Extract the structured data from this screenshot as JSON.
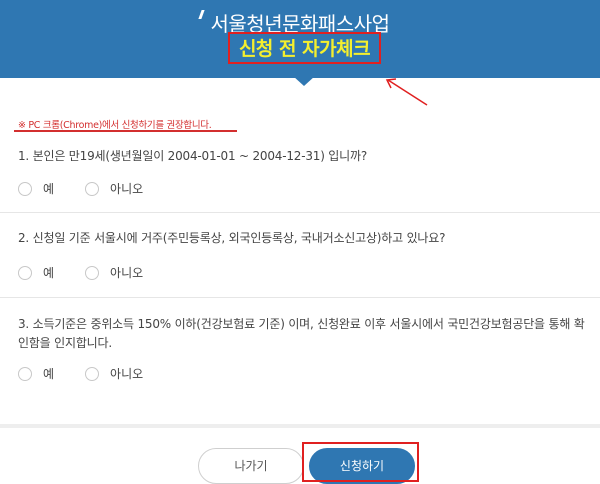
{
  "header": {
    "title": "서울청년문화패스사업",
    "subtitle": "신청 전 자가체크"
  },
  "notice": "※ PC 크롬(Chrome)에서 신청하기를 권장합니다.",
  "questions": [
    {
      "text": "1. 본인은 만19세(생년월일이 2004-01-01 ~ 2004-12-31) 입니까?",
      "options": [
        "예",
        "아니오"
      ]
    },
    {
      "text": "2. 신청일 기준 서울시에 거주(주민등록상, 외국인등록상, 국내거소신고상)하고 있나요?",
      "options": [
        "예",
        "아니오"
      ]
    },
    {
      "text": "3. 소득기준은 중위소득 150% 이하(건강보험료 기준) 이며, 신청완료 이후 서울시에서 국민건강보험공단을 통해 확인함을 인지합니다.",
      "options": [
        "예",
        "아니오"
      ]
    }
  ],
  "buttons": {
    "exit": "나가기",
    "apply": "신청하기"
  },
  "colors": {
    "header_bg": "#2f77b2",
    "subtitle_text": "#f4ef2e",
    "annotation_red": "#e02020"
  }
}
